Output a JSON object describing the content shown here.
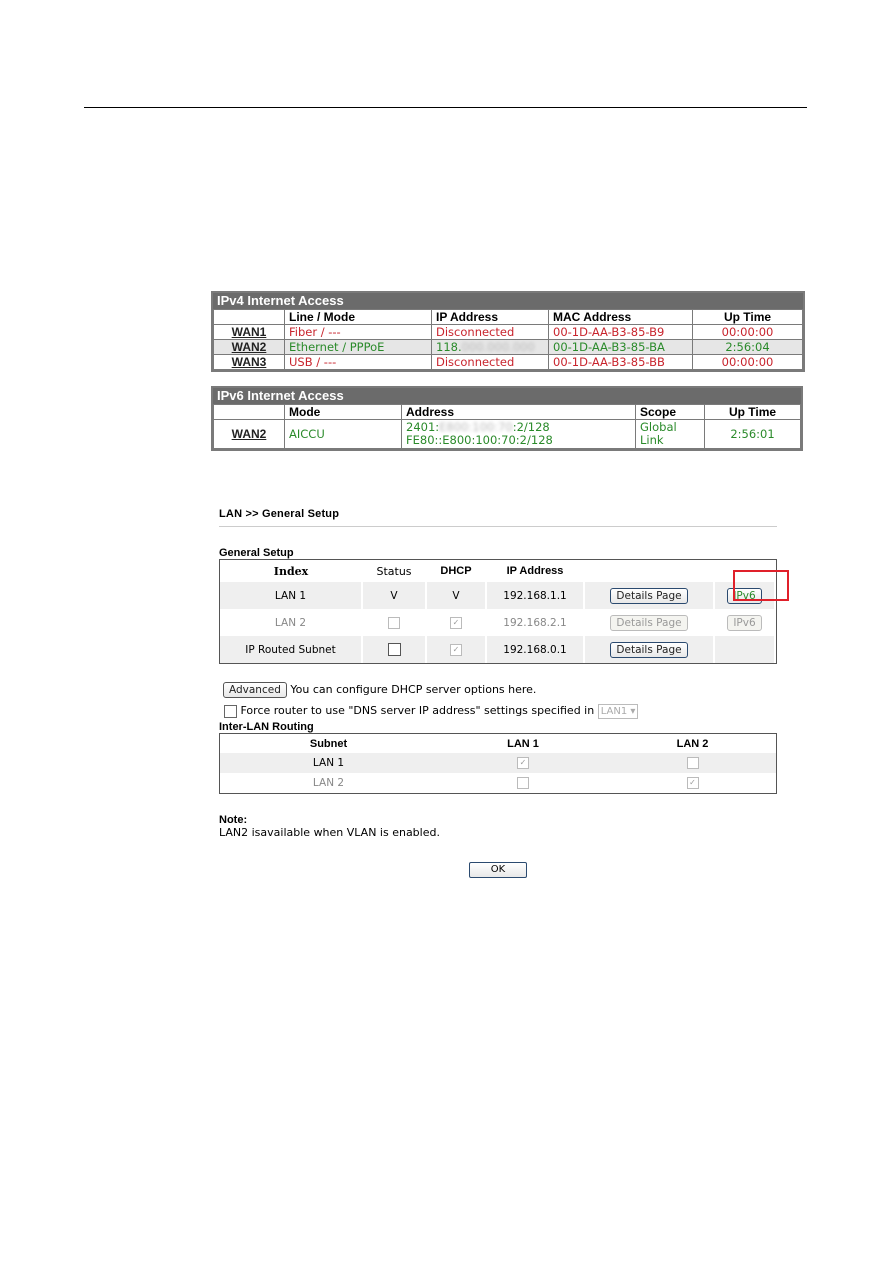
{
  "ipv4": {
    "title": "IPv4 Internet Access",
    "headers": [
      "",
      "Line / Mode",
      "IP Address",
      "MAC Address",
      "Up Time"
    ],
    "rows": [
      {
        "wan": "WAN1",
        "mode": "Fiber / ---",
        "ip": "Disconnected",
        "ip_blur": "",
        "mac": "00-1D-AA-B3-85-B9",
        "uptime": "00:00:00",
        "status": "down"
      },
      {
        "wan": "WAN2",
        "mode": "Ethernet / PPPoE",
        "ip": "118.",
        "ip_blur": "000.000.000",
        "mac": "00-1D-AA-B3-85-BA",
        "uptime": "2:56:04",
        "status": "up"
      },
      {
        "wan": "WAN3",
        "mode": "USB / ---",
        "ip": "Disconnected",
        "ip_blur": "",
        "mac": "00-1D-AA-B3-85-BB",
        "uptime": "00:00:00",
        "status": "down"
      }
    ]
  },
  "ipv6": {
    "title": "IPv6 Internet Access",
    "headers": [
      "",
      "Mode",
      "Address",
      "Scope",
      "Up Time"
    ],
    "row": {
      "wan": "WAN2",
      "mode": "AICCU",
      "addr1_prefix": "2401:",
      "addr1_blur": "E800:100:70",
      "addr1_suffix": ":2/128",
      "addr2": "FE80::E800:100:70:2/128",
      "scope1": "Global",
      "scope2": "Link",
      "uptime": "2:56:01"
    }
  },
  "lan": {
    "breadcrumb": "LAN >> General Setup",
    "general_title": "General Setup",
    "headers": [
      "Index",
      "Status",
      "DHCP",
      "IP Address"
    ],
    "rows": [
      {
        "index": "LAN 1",
        "status": "V",
        "dhcp": "V",
        "ip": "192.168.1.1",
        "details": "Details Page",
        "ipv6": "IPv6"
      },
      {
        "index": "LAN 2",
        "status": "",
        "dhcp": "",
        "ip": "192.168.2.1",
        "details": "Details Page",
        "ipv6": "IPv6"
      },
      {
        "index": "IP Routed Subnet",
        "status": "",
        "dhcp": "",
        "ip": "192.168.0.1",
        "details": "Details Page",
        "ipv6": ""
      }
    ],
    "advanced_label": "Advanced",
    "advanced_text": "You can configure DHCP server options here.",
    "force_dns_text": "Force router to use \"DNS server IP address\" settings specified in",
    "force_dns_select": "LAN1",
    "inter_title": "Inter-LAN Routing",
    "inter_headers": [
      "Subnet",
      "LAN 1",
      "LAN 2"
    ],
    "inter_rows": [
      {
        "subnet": "LAN 1",
        "lan1": true,
        "lan2": false
      },
      {
        "subnet": "LAN 2",
        "lan1": false,
        "lan2": true
      }
    ],
    "note_title": "Note:",
    "note_text": "LAN2 isavailable when VLAN is enabled.",
    "ok_label": "OK"
  },
  "colors": {
    "down": "#c8242d",
    "up": "#2a8a2a",
    "highlight": "#e0202a"
  }
}
